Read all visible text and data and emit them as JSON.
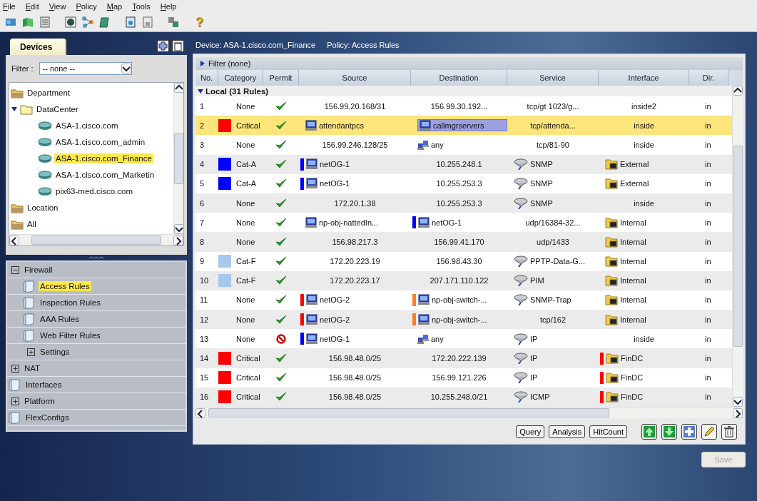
{
  "menu": [
    "File",
    "Edit",
    "View",
    "Policy",
    "Map",
    "Tools",
    "Help"
  ],
  "toolbar": {
    "help": "?"
  },
  "devices_panel": {
    "tab": "Devices",
    "filter_label": "Filter :",
    "filter_value": "-- none --",
    "tree": [
      {
        "label": "Department",
        "kind": "group",
        "selected": false
      },
      {
        "label": "DataCenter",
        "kind": "folder",
        "expanded": true,
        "selected": false,
        "children": [
          {
            "label": "ASA-1.cisco.com",
            "kind": "device",
            "selected": false
          },
          {
            "label": "ASA-1.cisco.com_admin",
            "kind": "device",
            "selected": false
          },
          {
            "label": "ASA-1.cisco.com_Finance",
            "kind": "device",
            "selected": true
          },
          {
            "label": "ASA-1.cisco.com_Marketin",
            "kind": "device",
            "selected": false
          },
          {
            "label": "pix63-med.cisco.com",
            "kind": "device",
            "selected": false
          }
        ]
      },
      {
        "label": "Location",
        "kind": "group",
        "selected": false
      },
      {
        "label": "All",
        "kind": "group",
        "selected": false
      }
    ]
  },
  "policy_nav": [
    {
      "label": "Firewall",
      "kind": "section",
      "expanded": true,
      "selected": false,
      "children": [
        {
          "label": "Access Rules",
          "kind": "page",
          "selected": true
        },
        {
          "label": "Inspection Rules",
          "kind": "page",
          "selected": false
        },
        {
          "label": "AAA Rules",
          "kind": "page",
          "selected": false
        },
        {
          "label": "Web Filter Rules",
          "kind": "page",
          "selected": false
        },
        {
          "label": "Settings",
          "kind": "section",
          "expanded": false,
          "selected": false
        }
      ]
    },
    {
      "label": "NAT",
      "kind": "section",
      "expanded": false,
      "selected": false
    },
    {
      "label": "Interfaces",
      "kind": "page",
      "selected": false
    },
    {
      "label": "Platform",
      "kind": "section",
      "expanded": false,
      "selected": false
    },
    {
      "label": "FlexConfigs",
      "kind": "page",
      "selected": false
    }
  ],
  "header": {
    "device": "Device: ASA-1.cisco.com_Finance",
    "policy": "Policy: Access Rules"
  },
  "filter": "Filter (none)",
  "table": {
    "columns": [
      "No.",
      "Category",
      "Permit",
      "Source",
      "Destination",
      "Service",
      "Interface",
      "Dir."
    ],
    "group": {
      "label": "Local (31 Rules)",
      "expanded": true
    },
    "rows": [
      {
        "no": "1",
        "selected": false,
        "category": {
          "label": "None"
        },
        "permit": true,
        "source": {
          "text": "156.99.20.168/31",
          "kind": "plain"
        },
        "destination": {
          "text": "156.99.30.192...",
          "kind": "plain"
        },
        "service": {
          "text": "tcp/gt 1023/g...",
          "kind": "plain"
        },
        "interface": {
          "text": "inside2",
          "kind": "plain"
        },
        "direction": "in"
      },
      {
        "no": "2",
        "selected": true,
        "category": {
          "label": "Critical",
          "color": "#ff0000"
        },
        "permit": true,
        "source": {
          "text": "attendantpcs",
          "kind": "host"
        },
        "destination": {
          "text": "callmgrservers",
          "kind": "host",
          "highlighted": true
        },
        "service": {
          "text": "tcp/attenda...",
          "kind": "plain"
        },
        "interface": {
          "text": "inside",
          "kind": "plain"
        },
        "direction": "in"
      },
      {
        "no": "3",
        "selected": false,
        "category": {
          "label": "None"
        },
        "permit": true,
        "source": {
          "text": "156.99.246.128/25",
          "kind": "plain"
        },
        "destination": {
          "text": "any",
          "kind": "network"
        },
        "service": {
          "text": "tcp/81-90",
          "kind": "plain"
        },
        "interface": {
          "text": "inside",
          "kind": "plain"
        },
        "direction": "in"
      },
      {
        "no": "4",
        "selected": false,
        "category": {
          "label": "Cat-A",
          "color": "#0000ff"
        },
        "permit": true,
        "source": {
          "text": "netOG-1",
          "kind": "host",
          "color": "#0000ff"
        },
        "destination": {
          "text": "10.255.248.1",
          "kind": "plain"
        },
        "service": {
          "text": "SNMP",
          "kind": "protocol"
        },
        "interface": {
          "text": "External",
          "kind": "folder"
        },
        "direction": "in"
      },
      {
        "no": "5",
        "selected": false,
        "category": {
          "label": "Cat-A",
          "color": "#0000ff"
        },
        "permit": true,
        "source": {
          "text": "netOG-1",
          "kind": "host",
          "color": "#0000ff"
        },
        "destination": {
          "text": "10.255.253.3",
          "kind": "plain"
        },
        "service": {
          "text": "SNMP",
          "kind": "protocol"
        },
        "interface": {
          "text": "External",
          "kind": "folder"
        },
        "direction": "in"
      },
      {
        "no": "6",
        "selected": false,
        "category": {
          "label": "None"
        },
        "permit": true,
        "source": {
          "text": "172.20.1.38",
          "kind": "plain"
        },
        "destination": {
          "text": "10.255.253.3",
          "kind": "plain"
        },
        "service": {
          "text": "SNMP",
          "kind": "protocol"
        },
        "interface": {
          "text": "inside",
          "kind": "plain"
        },
        "direction": "in"
      },
      {
        "no": "7",
        "selected": false,
        "category": {
          "label": "None"
        },
        "permit": true,
        "source": {
          "text": "np-obj-nattedIn...",
          "kind": "host"
        },
        "destination": {
          "text": "netOG-1",
          "kind": "host",
          "color": "#0000ff"
        },
        "service": {
          "text": "udp/16384-32...",
          "kind": "plain"
        },
        "interface": {
          "text": "Internal",
          "kind": "folder"
        },
        "direction": "in"
      },
      {
        "no": "8",
        "selected": false,
        "category": {
          "label": "None"
        },
        "permit": true,
        "source": {
          "text": "156.98.217.3",
          "kind": "plain"
        },
        "destination": {
          "text": "156.99.41.170",
          "kind": "plain"
        },
        "service": {
          "text": "udp/1433",
          "kind": "plain"
        },
        "interface": {
          "text": "Internal",
          "kind": "folder"
        },
        "direction": "in"
      },
      {
        "no": "9",
        "selected": false,
        "category": {
          "label": "Cat-F",
          "color": "#a6c8ef"
        },
        "permit": true,
        "source": {
          "text": "172.20.223.19",
          "kind": "plain"
        },
        "destination": {
          "text": "156.98.43.30",
          "kind": "plain"
        },
        "service": {
          "text": "PPTP-Data-G...",
          "kind": "protocol"
        },
        "interface": {
          "text": "Internal",
          "kind": "folder"
        },
        "direction": "in"
      },
      {
        "no": "10",
        "selected": false,
        "category": {
          "label": "Cat-F",
          "color": "#a6c8ef"
        },
        "permit": true,
        "source": {
          "text": "172.20.223.17",
          "kind": "plain"
        },
        "destination": {
          "text": "207.171.110.122",
          "kind": "plain"
        },
        "service": {
          "text": "PIM",
          "kind": "protocol"
        },
        "interface": {
          "text": "Internal",
          "kind": "folder"
        },
        "direction": "in"
      },
      {
        "no": "11",
        "selected": false,
        "category": {
          "label": "None"
        },
        "permit": true,
        "source": {
          "text": "netOG-2",
          "kind": "host",
          "color": "#ff0000"
        },
        "destination": {
          "text": "np-obj-switch-...",
          "kind": "host",
          "color": "#ff7f1e"
        },
        "service": {
          "text": "SNMP-Trap",
          "kind": "protocol"
        },
        "interface": {
          "text": "Internal",
          "kind": "folder"
        },
        "direction": "in"
      },
      {
        "no": "12",
        "selected": false,
        "category": {
          "label": "None"
        },
        "permit": true,
        "source": {
          "text": "netOG-2",
          "kind": "host",
          "color": "#ff0000"
        },
        "destination": {
          "text": "np-obj-switch-...",
          "kind": "host",
          "color": "#ff7f1e"
        },
        "service": {
          "text": "tcp/162",
          "kind": "plain"
        },
        "interface": {
          "text": "Internal",
          "kind": "folder"
        },
        "direction": "in"
      },
      {
        "no": "13",
        "selected": false,
        "category": {
          "label": "None"
        },
        "permit": false,
        "source": {
          "text": "netOG-1",
          "kind": "host",
          "color": "#0000ff"
        },
        "destination": {
          "text": "any",
          "kind": "network"
        },
        "service": {
          "text": "IP",
          "kind": "protocol"
        },
        "interface": {
          "text": "inside",
          "kind": "plain"
        },
        "direction": "in"
      },
      {
        "no": "14",
        "selected": false,
        "category": {
          "label": "Critical",
          "color": "#ff0000"
        },
        "permit": true,
        "source": {
          "text": "156.98.48.0/25",
          "kind": "plain"
        },
        "destination": {
          "text": "172.20.222.139",
          "kind": "plain"
        },
        "service": {
          "text": "IP",
          "kind": "protocol"
        },
        "interface": {
          "text": "FinDC",
          "kind": "folder",
          "color": "#ff0000"
        },
        "direction": "in"
      },
      {
        "no": "15",
        "selected": false,
        "category": {
          "label": "Critical",
          "color": "#ff0000"
        },
        "permit": true,
        "source": {
          "text": "156.98.48.0/25",
          "kind": "plain"
        },
        "destination": {
          "text": "156.99.121.226",
          "kind": "plain"
        },
        "service": {
          "text": "IP",
          "kind": "protocol"
        },
        "interface": {
          "text": "FinDC",
          "kind": "folder",
          "color": "#ff0000"
        },
        "direction": "in"
      },
      {
        "no": "16",
        "selected": false,
        "category": {
          "label": "Critical",
          "color": "#ff0000"
        },
        "permit": true,
        "source": {
          "text": "156.98.48.0/25",
          "kind": "plain"
        },
        "destination": {
          "text": "10.255.248.0/21",
          "kind": "plain"
        },
        "service": {
          "text": "ICMP",
          "kind": "protocol"
        },
        "interface": {
          "text": "FinDC",
          "kind": "folder",
          "color": "#ff0000"
        },
        "direction": "in"
      }
    ]
  },
  "actions": [
    "Query",
    "Analysis",
    "HitCount"
  ],
  "save": {
    "label": "Save",
    "disabled": true
  }
}
